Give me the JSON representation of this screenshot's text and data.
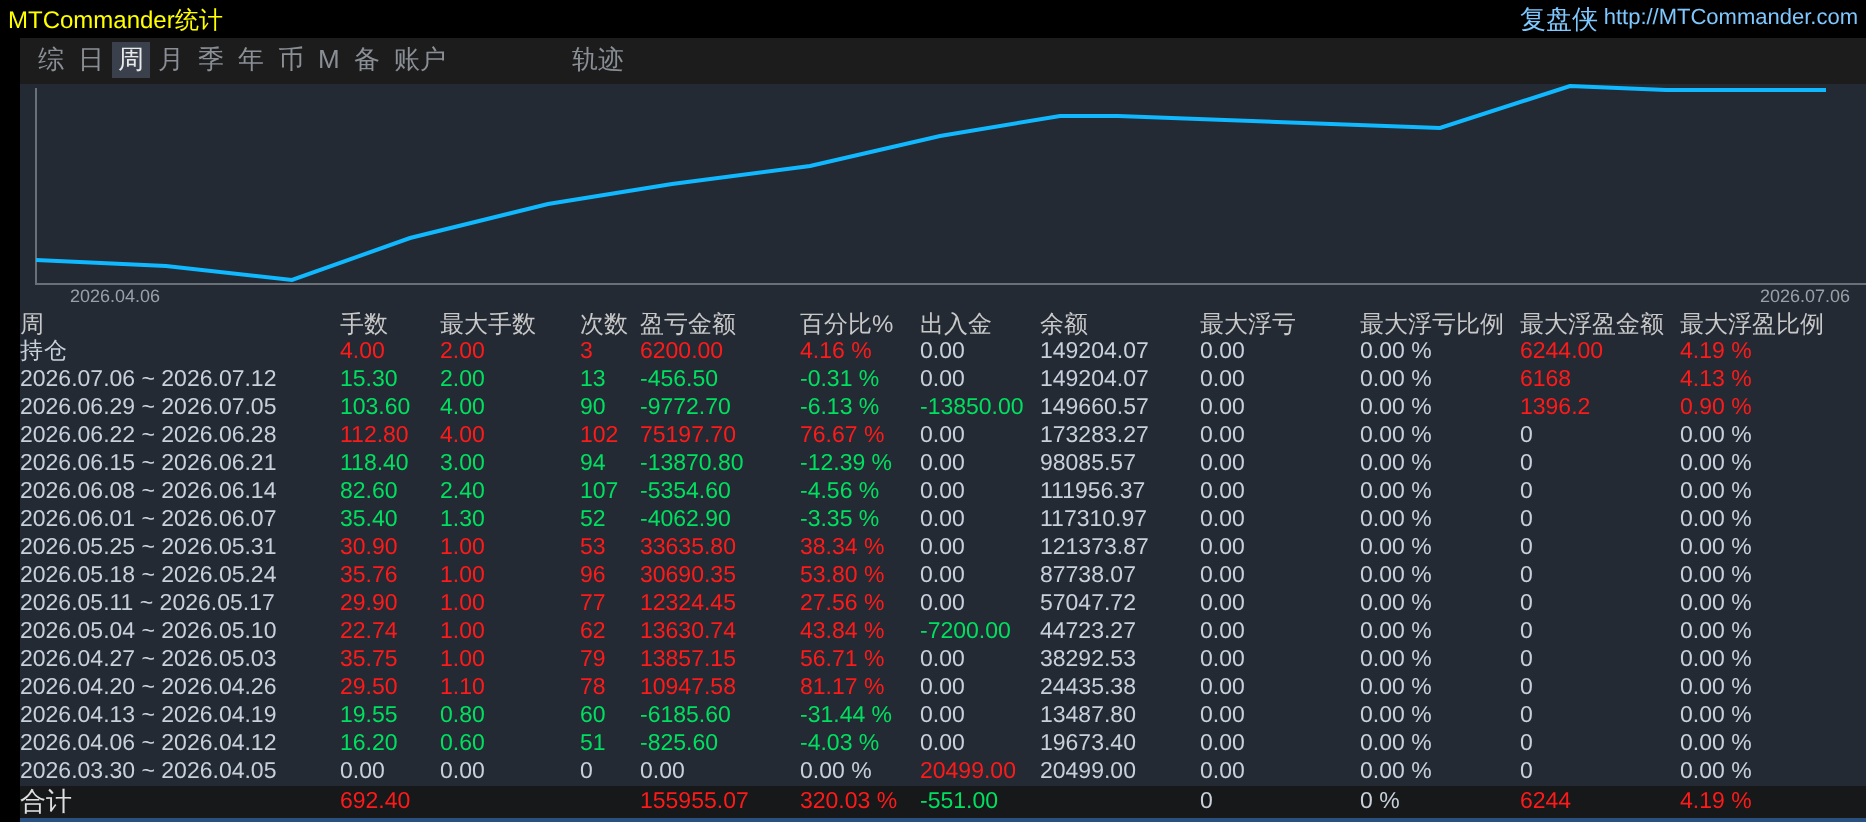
{
  "window": {
    "title": "MTCommander统计",
    "brand": "复盘侠",
    "url": "http://MTCommander.com"
  },
  "tabs": [
    {
      "label": "综",
      "selected": false
    },
    {
      "label": "日",
      "selected": false
    },
    {
      "label": "周",
      "selected": true
    },
    {
      "label": "月",
      "selected": false
    },
    {
      "label": "季",
      "selected": false
    },
    {
      "label": "年",
      "selected": false
    },
    {
      "label": "币",
      "selected": false
    },
    {
      "label": "M",
      "selected": false
    },
    {
      "label": "备",
      "selected": false
    },
    {
      "label": "账户",
      "selected": false
    }
  ],
  "view_tabs": [
    {
      "label": "轨迹",
      "selected": false
    }
  ],
  "chart": {
    "x_start": "2026.04.06",
    "x_end": "2026.07.06"
  },
  "table": {
    "columns": [
      "周",
      "手数",
      "最大手数",
      "次数",
      "盈亏金额",
      "百分比%",
      "出入金",
      "余额",
      "最大浮亏",
      "最大浮亏比例",
      "最大浮盈金额",
      "最大浮盈比例"
    ],
    "rows": [
      {
        "cells": [
          {
            "text": "持仓",
            "color": "#c8d0dc"
          },
          {
            "text": "4.00",
            "color": "#ff1a1a"
          },
          {
            "text": "2.00",
            "color": "#ff1a1a"
          },
          {
            "text": "3",
            "color": "#ff1a1a"
          },
          {
            "text": "6200.00",
            "color": "#ff1a1a"
          },
          {
            "text": "4.16 %",
            "color": "#ff1a1a"
          },
          {
            "text": "0.00",
            "color": "#c8d0dc"
          },
          {
            "text": "149204.07",
            "color": "#c8d0dc"
          },
          {
            "text": "0.00",
            "color": "#c8d0dc"
          },
          {
            "text": "0.00 %",
            "color": "#c8d0dc"
          },
          {
            "text": "6244.00",
            "color": "#ff1a1a"
          },
          {
            "text": "4.19 %",
            "color": "#ff1a1a"
          }
        ]
      },
      {
        "cells": [
          {
            "text": "2026.07.06 ~ 2026.07.12",
            "color": "#c8d0dc"
          },
          {
            "text": "15.30",
            "color": "#00e060"
          },
          {
            "text": "2.00",
            "color": "#00e060"
          },
          {
            "text": "13",
            "color": "#00e060"
          },
          {
            "text": "-456.50",
            "color": "#00e060"
          },
          {
            "text": "-0.31 %",
            "color": "#00e060"
          },
          {
            "text": "0.00",
            "color": "#c8d0dc"
          },
          {
            "text": "149204.07",
            "color": "#c8d0dc"
          },
          {
            "text": "0.00",
            "color": "#c8d0dc"
          },
          {
            "text": "0.00 %",
            "color": "#c8d0dc"
          },
          {
            "text": "6168",
            "color": "#ff1a1a"
          },
          {
            "text": "4.13 %",
            "color": "#ff1a1a"
          }
        ]
      },
      {
        "cells": [
          {
            "text": "2026.06.29 ~ 2026.07.05",
            "color": "#c8d0dc"
          },
          {
            "text": "103.60",
            "color": "#00e060"
          },
          {
            "text": "4.00",
            "color": "#00e060"
          },
          {
            "text": "90",
            "color": "#00e060"
          },
          {
            "text": "-9772.70",
            "color": "#00e060"
          },
          {
            "text": "-6.13 %",
            "color": "#00e060"
          },
          {
            "text": "-13850.00",
            "color": "#00e060"
          },
          {
            "text": "149660.57",
            "color": "#c8d0dc"
          },
          {
            "text": "0.00",
            "color": "#c8d0dc"
          },
          {
            "text": "0.00 %",
            "color": "#c8d0dc"
          },
          {
            "text": "1396.2",
            "color": "#ff1a1a"
          },
          {
            "text": "0.90 %",
            "color": "#ff1a1a"
          }
        ]
      },
      {
        "cells": [
          {
            "text": "2026.06.22 ~ 2026.06.28",
            "color": "#c8d0dc"
          },
          {
            "text": "112.80",
            "color": "#ff1a1a"
          },
          {
            "text": "4.00",
            "color": "#ff1a1a"
          },
          {
            "text": "102",
            "color": "#ff1a1a"
          },
          {
            "text": "75197.70",
            "color": "#ff1a1a"
          },
          {
            "text": "76.67 %",
            "color": "#ff1a1a"
          },
          {
            "text": "0.00",
            "color": "#c8d0dc"
          },
          {
            "text": "173283.27",
            "color": "#c8d0dc"
          },
          {
            "text": "0.00",
            "color": "#c8d0dc"
          },
          {
            "text": "0.00 %",
            "color": "#c8d0dc"
          },
          {
            "text": "0",
            "color": "#c8d0dc"
          },
          {
            "text": "0.00 %",
            "color": "#c8d0dc"
          }
        ]
      },
      {
        "cells": [
          {
            "text": "2026.06.15 ~ 2026.06.21",
            "color": "#c8d0dc"
          },
          {
            "text": "118.40",
            "color": "#00e060"
          },
          {
            "text": "3.00",
            "color": "#00e060"
          },
          {
            "text": "94",
            "color": "#00e060"
          },
          {
            "text": "-13870.80",
            "color": "#00e060"
          },
          {
            "text": "-12.39 %",
            "color": "#00e060"
          },
          {
            "text": "0.00",
            "color": "#c8d0dc"
          },
          {
            "text": "98085.57",
            "color": "#c8d0dc"
          },
          {
            "text": "0.00",
            "color": "#c8d0dc"
          },
          {
            "text": "0.00 %",
            "color": "#c8d0dc"
          },
          {
            "text": "0",
            "color": "#c8d0dc"
          },
          {
            "text": "0.00 %",
            "color": "#c8d0dc"
          }
        ]
      },
      {
        "cells": [
          {
            "text": "2026.06.08 ~ 2026.06.14",
            "color": "#c8d0dc"
          },
          {
            "text": "82.60",
            "color": "#00e060"
          },
          {
            "text": "2.40",
            "color": "#00e060"
          },
          {
            "text": "107",
            "color": "#00e060"
          },
          {
            "text": "-5354.60",
            "color": "#00e060"
          },
          {
            "text": "-4.56 %",
            "color": "#00e060"
          },
          {
            "text": "0.00",
            "color": "#c8d0dc"
          },
          {
            "text": "111956.37",
            "color": "#c8d0dc"
          },
          {
            "text": "0.00",
            "color": "#c8d0dc"
          },
          {
            "text": "0.00 %",
            "color": "#c8d0dc"
          },
          {
            "text": "0",
            "color": "#c8d0dc"
          },
          {
            "text": "0.00 %",
            "color": "#c8d0dc"
          }
        ]
      },
      {
        "cells": [
          {
            "text": "2026.06.01 ~ 2026.06.07",
            "color": "#c8d0dc"
          },
          {
            "text": "35.40",
            "color": "#00e060"
          },
          {
            "text": "1.30",
            "color": "#00e060"
          },
          {
            "text": "52",
            "color": "#00e060"
          },
          {
            "text": "-4062.90",
            "color": "#00e060"
          },
          {
            "text": "-3.35 %",
            "color": "#00e060"
          },
          {
            "text": "0.00",
            "color": "#c8d0dc"
          },
          {
            "text": "117310.97",
            "color": "#c8d0dc"
          },
          {
            "text": "0.00",
            "color": "#c8d0dc"
          },
          {
            "text": "0.00 %",
            "color": "#c8d0dc"
          },
          {
            "text": "0",
            "color": "#c8d0dc"
          },
          {
            "text": "0.00 %",
            "color": "#c8d0dc"
          }
        ]
      },
      {
        "cells": [
          {
            "text": "2026.05.25 ~ 2026.05.31",
            "color": "#c8d0dc"
          },
          {
            "text": "30.90",
            "color": "#ff1a1a"
          },
          {
            "text": "1.00",
            "color": "#ff1a1a"
          },
          {
            "text": "53",
            "color": "#ff1a1a"
          },
          {
            "text": "33635.80",
            "color": "#ff1a1a"
          },
          {
            "text": "38.34 %",
            "color": "#ff1a1a"
          },
          {
            "text": "0.00",
            "color": "#c8d0dc"
          },
          {
            "text": "121373.87",
            "color": "#c8d0dc"
          },
          {
            "text": "0.00",
            "color": "#c8d0dc"
          },
          {
            "text": "0.00 %",
            "color": "#c8d0dc"
          },
          {
            "text": "0",
            "color": "#c8d0dc"
          },
          {
            "text": "0.00 %",
            "color": "#c8d0dc"
          }
        ]
      },
      {
        "cells": [
          {
            "text": "2026.05.18 ~ 2026.05.24",
            "color": "#c8d0dc"
          },
          {
            "text": "35.76",
            "color": "#ff1a1a"
          },
          {
            "text": "1.00",
            "color": "#ff1a1a"
          },
          {
            "text": "96",
            "color": "#ff1a1a"
          },
          {
            "text": "30690.35",
            "color": "#ff1a1a"
          },
          {
            "text": "53.80 %",
            "color": "#ff1a1a"
          },
          {
            "text": "0.00",
            "color": "#c8d0dc"
          },
          {
            "text": "87738.07",
            "color": "#c8d0dc"
          },
          {
            "text": "0.00",
            "color": "#c8d0dc"
          },
          {
            "text": "0.00 %",
            "color": "#c8d0dc"
          },
          {
            "text": "0",
            "color": "#c8d0dc"
          },
          {
            "text": "0.00 %",
            "color": "#c8d0dc"
          }
        ]
      },
      {
        "cells": [
          {
            "text": "2026.05.11 ~ 2026.05.17",
            "color": "#c8d0dc"
          },
          {
            "text": "29.90",
            "color": "#ff1a1a"
          },
          {
            "text": "1.00",
            "color": "#ff1a1a"
          },
          {
            "text": "77",
            "color": "#ff1a1a"
          },
          {
            "text": "12324.45",
            "color": "#ff1a1a"
          },
          {
            "text": "27.56 %",
            "color": "#ff1a1a"
          },
          {
            "text": "0.00",
            "color": "#c8d0dc"
          },
          {
            "text": "57047.72",
            "color": "#c8d0dc"
          },
          {
            "text": "0.00",
            "color": "#c8d0dc"
          },
          {
            "text": "0.00 %",
            "color": "#c8d0dc"
          },
          {
            "text": "0",
            "color": "#c8d0dc"
          },
          {
            "text": "0.00 %",
            "color": "#c8d0dc"
          }
        ]
      },
      {
        "cells": [
          {
            "text": "2026.05.04 ~ 2026.05.10",
            "color": "#c8d0dc"
          },
          {
            "text": "22.74",
            "color": "#ff1a1a"
          },
          {
            "text": "1.00",
            "color": "#ff1a1a"
          },
          {
            "text": "62",
            "color": "#ff1a1a"
          },
          {
            "text": "13630.74",
            "color": "#ff1a1a"
          },
          {
            "text": "43.84 %",
            "color": "#ff1a1a"
          },
          {
            "text": "-7200.00",
            "color": "#00e060"
          },
          {
            "text": "44723.27",
            "color": "#c8d0dc"
          },
          {
            "text": "0.00",
            "color": "#c8d0dc"
          },
          {
            "text": "0.00 %",
            "color": "#c8d0dc"
          },
          {
            "text": "0",
            "color": "#c8d0dc"
          },
          {
            "text": "0.00 %",
            "color": "#c8d0dc"
          }
        ]
      },
      {
        "cells": [
          {
            "text": "2026.04.27 ~ 2026.05.03",
            "color": "#c8d0dc"
          },
          {
            "text": "35.75",
            "color": "#ff1a1a"
          },
          {
            "text": "1.00",
            "color": "#ff1a1a"
          },
          {
            "text": "79",
            "color": "#ff1a1a"
          },
          {
            "text": "13857.15",
            "color": "#ff1a1a"
          },
          {
            "text": "56.71 %",
            "color": "#ff1a1a"
          },
          {
            "text": "0.00",
            "color": "#c8d0dc"
          },
          {
            "text": "38292.53",
            "color": "#c8d0dc"
          },
          {
            "text": "0.00",
            "color": "#c8d0dc"
          },
          {
            "text": "0.00 %",
            "color": "#c8d0dc"
          },
          {
            "text": "0",
            "color": "#c8d0dc"
          },
          {
            "text": "0.00 %",
            "color": "#c8d0dc"
          }
        ]
      },
      {
        "cells": [
          {
            "text": "2026.04.20 ~ 2026.04.26",
            "color": "#c8d0dc"
          },
          {
            "text": "29.50",
            "color": "#ff1a1a"
          },
          {
            "text": "1.10",
            "color": "#ff1a1a"
          },
          {
            "text": "78",
            "color": "#ff1a1a"
          },
          {
            "text": "10947.58",
            "color": "#ff1a1a"
          },
          {
            "text": "81.17 %",
            "color": "#ff1a1a"
          },
          {
            "text": "0.00",
            "color": "#c8d0dc"
          },
          {
            "text": "24435.38",
            "color": "#c8d0dc"
          },
          {
            "text": "0.00",
            "color": "#c8d0dc"
          },
          {
            "text": "0.00 %",
            "color": "#c8d0dc"
          },
          {
            "text": "0",
            "color": "#c8d0dc"
          },
          {
            "text": "0.00 %",
            "color": "#c8d0dc"
          }
        ]
      },
      {
        "cells": [
          {
            "text": "2026.04.13 ~ 2026.04.19",
            "color": "#c8d0dc"
          },
          {
            "text": "19.55",
            "color": "#00e060"
          },
          {
            "text": "0.80",
            "color": "#00e060"
          },
          {
            "text": "60",
            "color": "#00e060"
          },
          {
            "text": "-6185.60",
            "color": "#00e060"
          },
          {
            "text": "-31.44 %",
            "color": "#00e060"
          },
          {
            "text": "0.00",
            "color": "#c8d0dc"
          },
          {
            "text": "13487.80",
            "color": "#c8d0dc"
          },
          {
            "text": "0.00",
            "color": "#c8d0dc"
          },
          {
            "text": "0.00 %",
            "color": "#c8d0dc"
          },
          {
            "text": "0",
            "color": "#c8d0dc"
          },
          {
            "text": "0.00 %",
            "color": "#c8d0dc"
          }
        ]
      },
      {
        "cells": [
          {
            "text": "2026.04.06 ~ 2026.04.12",
            "color": "#c8d0dc"
          },
          {
            "text": "16.20",
            "color": "#00e060"
          },
          {
            "text": "0.60",
            "color": "#00e060"
          },
          {
            "text": "51",
            "color": "#00e060"
          },
          {
            "text": "-825.60",
            "color": "#00e060"
          },
          {
            "text": "-4.03 %",
            "color": "#00e060"
          },
          {
            "text": "0.00",
            "color": "#c8d0dc"
          },
          {
            "text": "19673.40",
            "color": "#c8d0dc"
          },
          {
            "text": "0.00",
            "color": "#c8d0dc"
          },
          {
            "text": "0.00 %",
            "color": "#c8d0dc"
          },
          {
            "text": "0",
            "color": "#c8d0dc"
          },
          {
            "text": "0.00 %",
            "color": "#c8d0dc"
          }
        ]
      },
      {
        "cells": [
          {
            "text": "2026.03.30 ~ 2026.04.05",
            "color": "#c8d0dc"
          },
          {
            "text": "0.00",
            "color": "#c8d0dc"
          },
          {
            "text": "0.00",
            "color": "#c8d0dc"
          },
          {
            "text": "0",
            "color": "#c8d0dc"
          },
          {
            "text": "0.00",
            "color": "#c8d0dc"
          },
          {
            "text": "0.00 %",
            "color": "#c8d0dc"
          },
          {
            "text": "20499.00",
            "color": "#ff1a1a"
          },
          {
            "text": "20499.00",
            "color": "#c8d0dc"
          },
          {
            "text": "0.00",
            "color": "#c8d0dc"
          },
          {
            "text": "0.00 %",
            "color": "#c8d0dc"
          },
          {
            "text": "0",
            "color": "#c8d0dc"
          },
          {
            "text": "0.00 %",
            "color": "#c8d0dc"
          }
        ]
      }
    ],
    "total": {
      "cells": [
        {
          "text": "合计",
          "color": "#e0e0e0"
        },
        {
          "text": "692.40",
          "color": "#ff1a1a"
        },
        null,
        null,
        {
          "text": "155955.07",
          "color": "#ff1a1a"
        },
        {
          "text": "320.03 %",
          "color": "#ff1a1a"
        },
        {
          "text": "-551.00",
          "color": "#00e060"
        },
        null,
        {
          "text": "0",
          "color": "#c8d0dc"
        },
        {
          "text": "0 %",
          "color": "#c8d0dc"
        },
        {
          "text": "6244",
          "color": "#ff1a1a"
        },
        {
          "text": "4.19 %",
          "color": "#ff1a1a"
        }
      ]
    }
  }
}
